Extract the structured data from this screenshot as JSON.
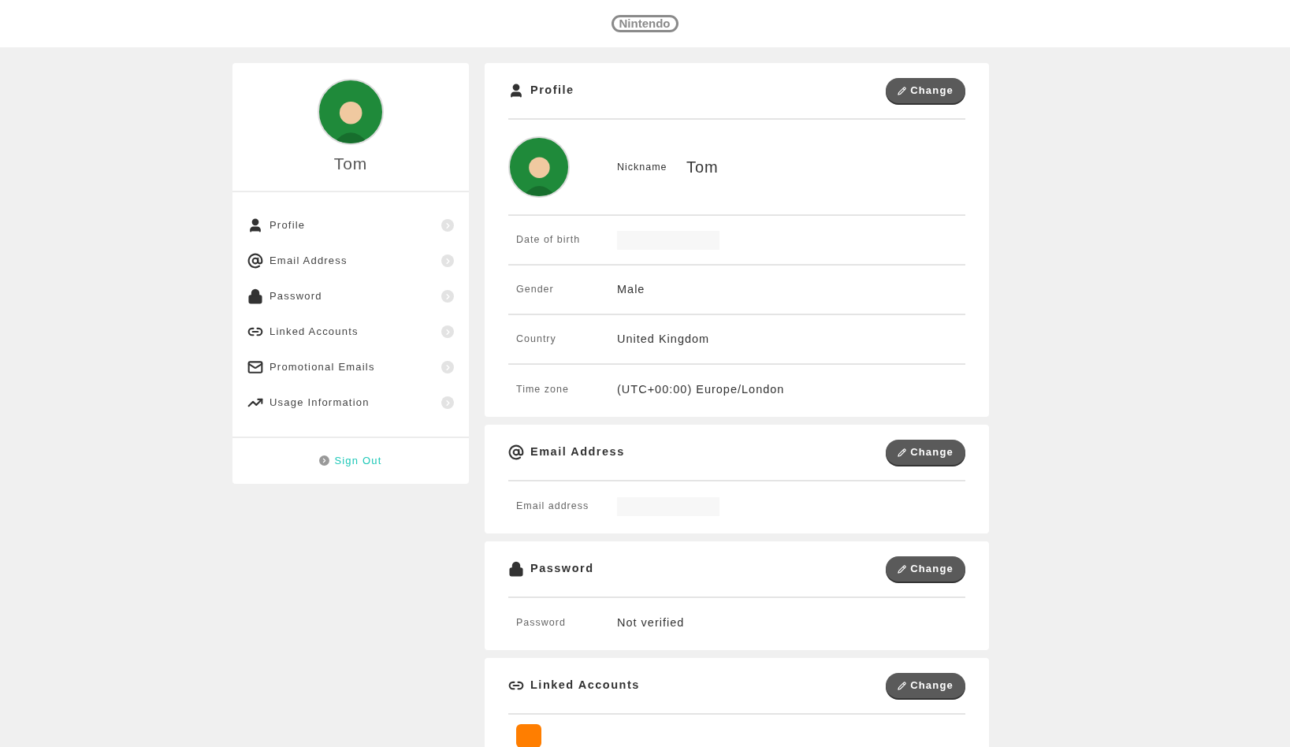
{
  "header": {
    "logo": "Nintendo"
  },
  "sidebar": {
    "user_name": "Tom",
    "items": [
      {
        "kind": "person",
        "label": "Profile"
      },
      {
        "kind": "at",
        "label": "Email Address"
      },
      {
        "kind": "lock",
        "label": "Password"
      },
      {
        "kind": "link",
        "label": "Linked Accounts"
      },
      {
        "kind": "mail",
        "label": "Promotional Emails"
      },
      {
        "kind": "chart",
        "label": "Usage Information"
      }
    ],
    "sign_out": "Sign Out"
  },
  "sections": [
    {
      "kind": "person",
      "title": "Profile",
      "button": "Change",
      "nickname": {
        "label": "Nickname",
        "value": "Tom"
      },
      "rows": [
        {
          "kind": "redacted",
          "label": "Date of birth"
        },
        {
          "kind": "text",
          "label": "Gender",
          "value": "Male"
        },
        {
          "kind": "text",
          "label": "Country",
          "value": "United Kingdom"
        },
        {
          "kind": "text",
          "label": "Time zone",
          "value": "(UTC+00:00) Europe/London"
        }
      ]
    },
    {
      "kind": "at",
      "title": "Email Address",
      "button": "Change",
      "rows": [
        {
          "kind": "redacted",
          "label": "Email address"
        }
      ]
    },
    {
      "kind": "lock",
      "title": "Password",
      "button": "Change",
      "rows": [
        {
          "kind": "text",
          "label": "Password",
          "value": "Not verified"
        }
      ]
    },
    {
      "kind": "link",
      "title": "Linked Accounts",
      "button": "Change",
      "rows": [
        {
          "kind": "service"
        }
      ]
    }
  ]
}
